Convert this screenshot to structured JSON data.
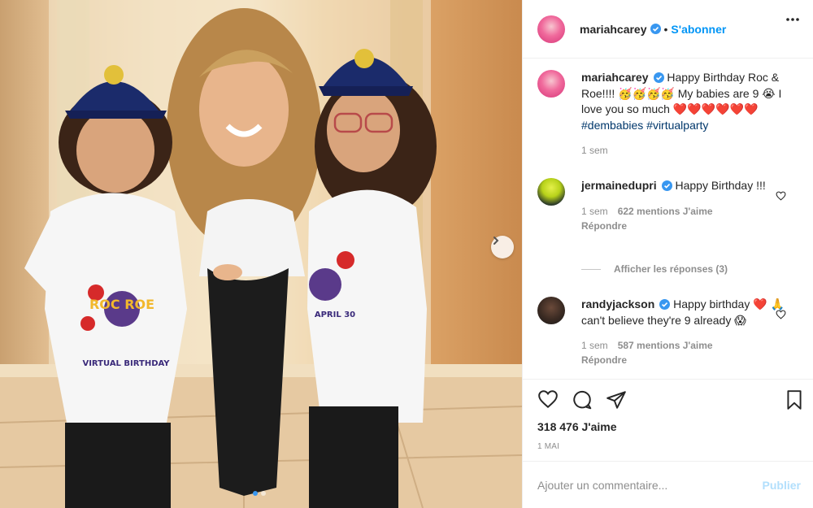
{
  "post": {
    "author": "mariahcarey",
    "follow_label": "S'abonner",
    "separator": "•",
    "caption_text": "Happy Birthday Roc & Roe!!!! 🥳🥳🥳🥳 My babies are 9 😭 I love you so much ❤️❤️❤️❤️❤️❤️",
    "hashtags": "#dembabies #virtualparty",
    "caption_time": "1 sem"
  },
  "comments": [
    {
      "username": "jermainedupri",
      "text": "Happy Birthday !!!",
      "time": "1 sem",
      "likes": "622 mentions J'aime",
      "reply": "Répondre",
      "show_replies": "Afficher les réponses (3)"
    },
    {
      "username": "randyjackson",
      "text": "Happy birthday ❤️ 🙏 can't believe they're 9 already 😱",
      "time": "1 sem",
      "likes": "587 mentions J'aime",
      "reply": "Répondre"
    }
  ],
  "footer": {
    "likes_count": "318 476 J'aime",
    "date": "1 MAI",
    "comment_placeholder": "Ajouter un commentaire...",
    "publish_label": "Publier"
  },
  "photo": {
    "shirt_text_left": "ROC ROE",
    "shirt_text_left_sub": "VIRTUAL BIRTHDAY",
    "shirt_text_right": "APRIL 30",
    "carousel": {
      "current": 1,
      "total": 2
    }
  },
  "colors": {
    "accent": "#0095f6",
    "verified": "#3897f0",
    "hashtag": "#00376b",
    "muted": "#8e8e8e",
    "publish_disabled": "#b2dffc"
  }
}
